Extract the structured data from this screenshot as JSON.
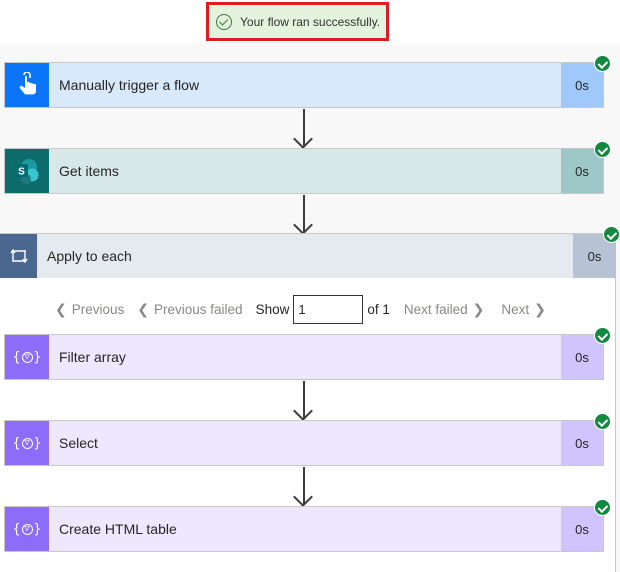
{
  "banner": {
    "message": "Your flow ran successfully.",
    "icon": "check-circle-icon"
  },
  "steps": [
    {
      "title": "Manually trigger a flow",
      "duration": "0s",
      "icon": "touch-hand-icon",
      "status": "succeeded"
    },
    {
      "title": "Get items",
      "duration": "0s",
      "icon": "sharepoint-icon",
      "status": "succeeded"
    },
    {
      "title": "Apply to each",
      "duration": "0s",
      "icon": "loop-icon",
      "status": "succeeded"
    }
  ],
  "pager": {
    "previous": "Previous",
    "previous_failed": "Previous failed",
    "show": "Show",
    "current": "1",
    "of": "of 1",
    "next_failed": "Next failed",
    "next": "Next"
  },
  "inner_steps": [
    {
      "title": "Filter array",
      "duration": "0s",
      "icon": "data-operation-icon",
      "status": "succeeded"
    },
    {
      "title": "Select",
      "duration": "0s",
      "icon": "data-operation-icon",
      "status": "succeeded"
    },
    {
      "title": "Create HTML table",
      "duration": "0s",
      "icon": "data-operation-icon",
      "status": "succeeded"
    }
  ],
  "colors": {
    "success": "#13883f",
    "trigger": "#0a75f9",
    "sharepoint": "#0e6c6d",
    "control": "#4a6790",
    "data_operation": "#8c6cf8",
    "highlight_border": "#e01b24"
  }
}
